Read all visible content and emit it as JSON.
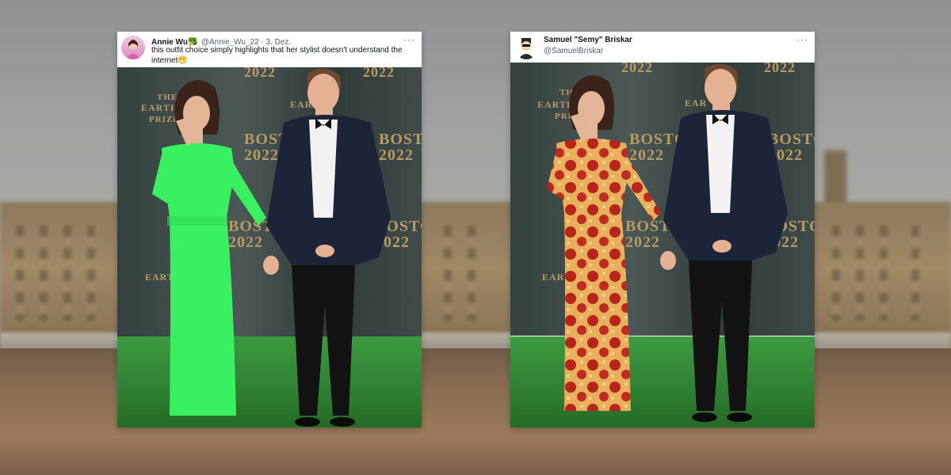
{
  "left_tweet": {
    "name": "Annie Wu",
    "name_emoji": "🥦",
    "handle_date": "@Annie_Wu_22 · 3. Dez.",
    "text": "this outfit choice simply highlights that her stylist doesn't understand the internet😬",
    "more_label": "···",
    "dress_color": "#39f060",
    "backdrop": {
      "word_a": "THE",
      "word_b": "EARTHSHOT",
      "word_c": "PRIZE",
      "city": "BOSTON",
      "year": "2022",
      "partial": "EARTH"
    }
  },
  "right_tweet": {
    "name": "Samuel \"Semy\" Briskar",
    "handle": "@SamuelBriskar",
    "more_label": "···",
    "dress_pattern": "pepperoni-pizza",
    "backdrop": {
      "word_a": "TH",
      "word_b": "EARTHSHOT",
      "word_c": "PRI",
      "city": "BOSTON",
      "year": "2022",
      "partial": "EAR"
    }
  }
}
